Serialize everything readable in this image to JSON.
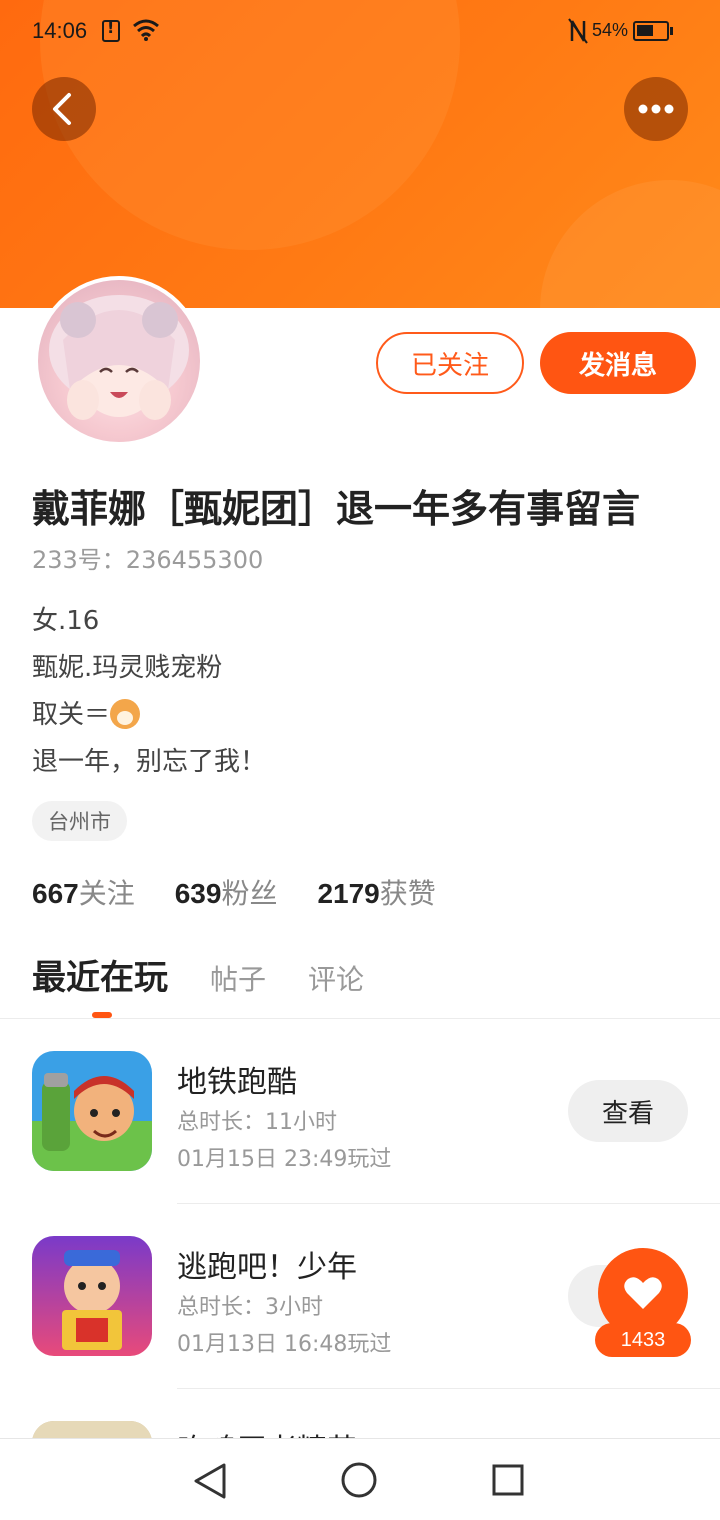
{
  "status_bar": {
    "time": "14:06",
    "battery_percent": "54%"
  },
  "profile": {
    "name": "戴菲娜［甄妮团］退一年多有事留言",
    "id_line": "233号：236455300",
    "bio_lines": [
      "女.16",
      "甄妮.玛灵贱宠粉",
      "取关＝",
      "退一年，别忘了我！"
    ],
    "location": "台州市"
  },
  "actions": {
    "following_label": "已关注",
    "message_label": "发消息"
  },
  "stats": [
    {
      "num": "667",
      "label": "关注"
    },
    {
      "num": "639",
      "label": "粉丝"
    },
    {
      "num": "2179",
      "label": "获赞"
    }
  ],
  "tabs": [
    {
      "label": "最近在玩",
      "active": true
    },
    {
      "label": "帖子",
      "active": false
    },
    {
      "label": "评论",
      "active": false
    }
  ],
  "games": [
    {
      "title": "地铁跑酷",
      "duration": "总时长：11小时",
      "last_played": "01月15日 23:49玩过",
      "button": "查看"
    },
    {
      "title": "逃跑吧！少年",
      "duration": "总时长：3小时",
      "last_played": "01月13日 16:48玩过",
      "button": "查看"
    },
    {
      "title": "吃鸡王者精英",
      "duration": "",
      "last_played": "",
      "button": ""
    }
  ],
  "like_fab": {
    "count": "1433"
  },
  "colors": {
    "accent": "#ff5512",
    "header_gradient_start": "#ff6a0f",
    "header_gradient_end": "#ff8a1a"
  },
  "icons": {
    "back": "back-arrow-icon",
    "more": "more-dots-icon",
    "like": "heart-icon",
    "nav_back": "triangle-back-icon",
    "nav_home": "circle-home-icon",
    "nav_recent": "square-recent-icon"
  }
}
